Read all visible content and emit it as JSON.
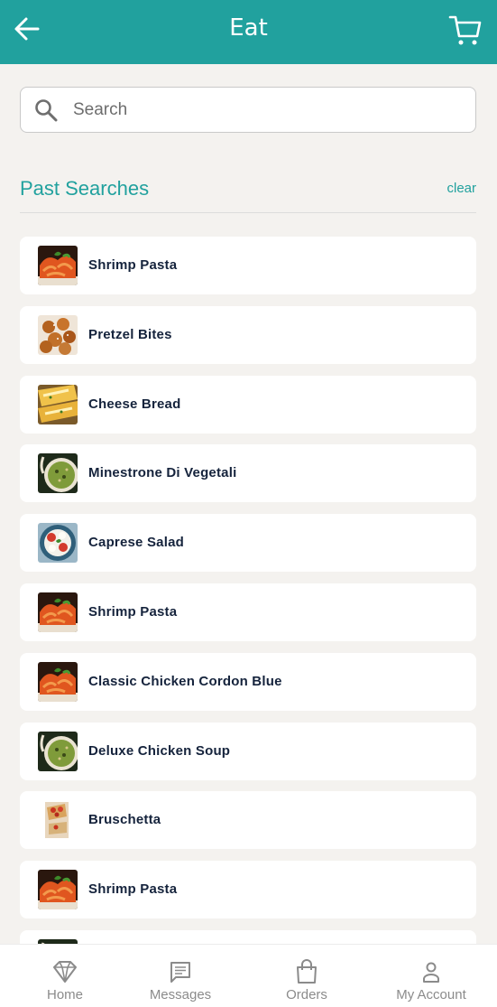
{
  "header": {
    "title": "Eat",
    "back_icon": "arrow-left-icon",
    "cart_icon": "shopping-cart-icon",
    "background": "#21a19e"
  },
  "search": {
    "placeholder": "Search",
    "value": "",
    "icon": "search-icon"
  },
  "past_searches": {
    "title": "Past Searches",
    "clear_label": "clear",
    "accent_color": "#21a19e",
    "items": [
      {
        "label": "Shrimp Pasta",
        "thumb": "pasta"
      },
      {
        "label": "Pretzel Bites",
        "thumb": "pretzel"
      },
      {
        "label": "Cheese Bread",
        "thumb": "bread"
      },
      {
        "label": "Minestrone Di Vegetali",
        "thumb": "soup"
      },
      {
        "label": "Caprese Salad",
        "thumb": "salad"
      },
      {
        "label": "Shrimp Pasta",
        "thumb": "pasta"
      },
      {
        "label": "Classic Chicken Cordon Blue",
        "thumb": "pasta"
      },
      {
        "label": "Deluxe Chicken Soup",
        "thumb": "soup"
      },
      {
        "label": "Bruschetta",
        "thumb": "bruschetta"
      },
      {
        "label": "Shrimp Pasta",
        "thumb": "pasta"
      },
      {
        "label": "",
        "thumb": "soup"
      }
    ]
  },
  "bottom_nav": {
    "items": [
      {
        "label": "Home",
        "icon": "home-gem-icon"
      },
      {
        "label": "Messages",
        "icon": "message-icon"
      },
      {
        "label": "Orders",
        "icon": "shopping-bag-icon"
      },
      {
        "label": "My Account",
        "icon": "person-icon"
      }
    ]
  }
}
